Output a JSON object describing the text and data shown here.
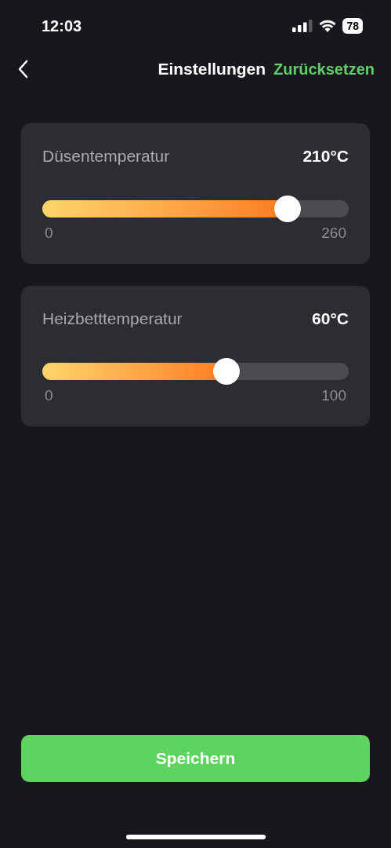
{
  "status_bar": {
    "time": "12:03",
    "battery": "78"
  },
  "header": {
    "title": "Einstellungen",
    "action": "Zurücksetzen"
  },
  "sliders": [
    {
      "label": "Düsentemperatur",
      "reading": "210°C",
      "level": 0.8,
      "min": "0",
      "max": "260"
    },
    {
      "label": "Heizbetttemperatur",
      "reading": "60°C",
      "level": 0.6,
      "min": "0",
      "max": "100"
    }
  ],
  "save_button": "Speichern"
}
